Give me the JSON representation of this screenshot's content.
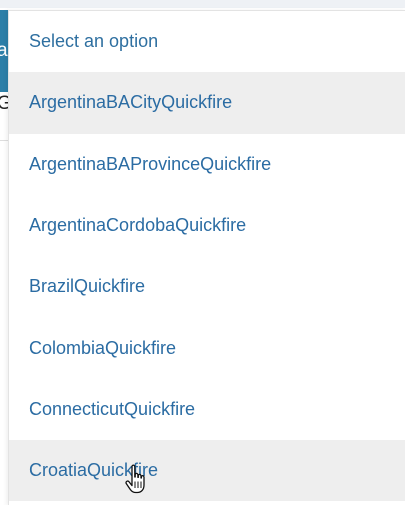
{
  "background_control": {
    "button_glyph": "a",
    "side_text": "G"
  },
  "dropdown": {
    "placeholder": "Select an option",
    "options": [
      "ArgentinaBACityQuickfire",
      "ArgentinaBAProvinceQuickfire",
      "ArgentinaCordobaQuickfire",
      "BrazilQuickfire",
      "ColombiaQuickfire",
      "ConnecticutQuickfire",
      "CroatiaQuickfire"
    ],
    "highlighted_option": "ArgentinaBACityQuickfire",
    "hovered_option": "CroatiaQuickfire"
  },
  "colors": {
    "link_text": "#2b6ca3",
    "highlight_bg": "#eeeeee",
    "button_blue": "#2d7fa8"
  },
  "icons": {
    "cursor": "hand-pointer-icon"
  }
}
